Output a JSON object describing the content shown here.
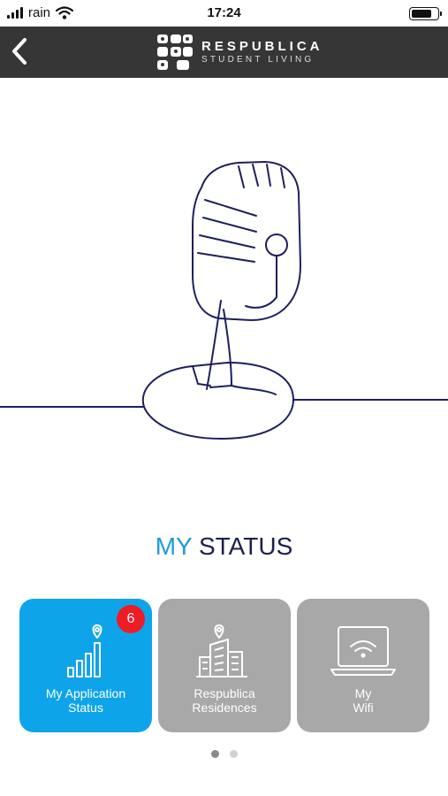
{
  "status_bar": {
    "carrier": "rain",
    "time": "17:24"
  },
  "nav": {
    "brand_title": "RESPUBLICA",
    "brand_subtitle": "STUDENT LIVING"
  },
  "heading": {
    "part1": "MY",
    "part2": "STATUS"
  },
  "tiles": [
    {
      "label": "My Application\nStatus",
      "icon": "bar-chart-location-icon",
      "state": "active",
      "badge": "6"
    },
    {
      "label": "Respublica\nResidences",
      "icon": "buildings-location-icon",
      "state": "inactive"
    },
    {
      "label": "My\nWifi",
      "icon": "laptop-wifi-icon",
      "state": "inactive"
    }
  ],
  "pager": {
    "pages": 2,
    "current": 1
  },
  "colors": {
    "nav_background": "#363636",
    "accent_blue": "#0ea4ea",
    "heading_dark": "#1d1f4f",
    "heading_light": "#1e9bd7",
    "tile_inactive": "#a8a8a8",
    "badge": "#ee1c24",
    "illustration_line": "#1d1f5e"
  }
}
